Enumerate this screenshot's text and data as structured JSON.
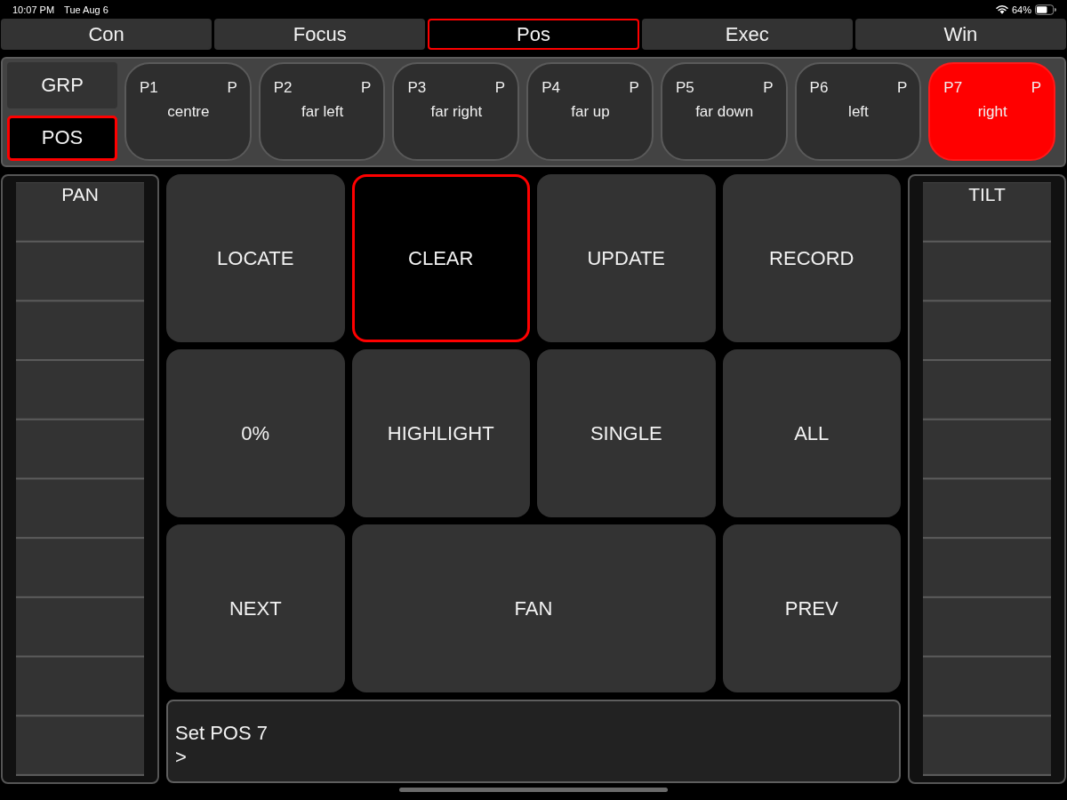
{
  "status_bar": {
    "time": "10:07 PM",
    "date": "Tue Aug 6",
    "battery": "64%"
  },
  "tabs": [
    {
      "label": "Con",
      "selected": false
    },
    {
      "label": "Focus",
      "selected": false
    },
    {
      "label": "Pos",
      "selected": true
    },
    {
      "label": "Exec",
      "selected": false
    },
    {
      "label": "Win",
      "selected": false
    }
  ],
  "palette": {
    "modes": [
      {
        "label": "GRP",
        "selected": false
      },
      {
        "label": "POS",
        "selected": true
      }
    ],
    "presets": [
      {
        "number": "P1",
        "tag": "P",
        "name": "centre",
        "selected": false
      },
      {
        "number": "P2",
        "tag": "P",
        "name": "far left",
        "selected": false
      },
      {
        "number": "P3",
        "tag": "P",
        "name": "far right",
        "selected": false
      },
      {
        "number": "P4",
        "tag": "P",
        "name": "far up",
        "selected": false
      },
      {
        "number": "P5",
        "tag": "P",
        "name": "far down",
        "selected": false
      },
      {
        "number": "P6",
        "tag": "P",
        "name": "left",
        "selected": false
      },
      {
        "number": "P7",
        "tag": "P",
        "name": "right",
        "selected": true
      }
    ]
  },
  "faders": [
    {
      "label": "PAN"
    },
    {
      "label": "TILT"
    }
  ],
  "keys": [
    {
      "label": "LOCATE",
      "kind": "single",
      "active": false
    },
    {
      "label": "CLEAR",
      "kind": "single",
      "active": true
    },
    {
      "label": "UPDATE",
      "kind": "single",
      "active": false
    },
    {
      "label": "RECORD",
      "kind": "single",
      "active": false
    },
    {
      "label": "0%",
      "kind": "single",
      "active": false
    },
    {
      "label": "HIGHLIGHT",
      "kind": "single",
      "active": false
    },
    {
      "label": "SINGLE",
      "kind": "single",
      "active": false
    },
    {
      "label": "ALL",
      "kind": "single",
      "active": false
    },
    {
      "label": "NEXT",
      "kind": "single",
      "active": false
    },
    {
      "label": "FAN",
      "kind": "double",
      "active": false
    },
    {
      "label": "PREV",
      "kind": "single",
      "active": false
    }
  ],
  "command_line": {
    "lines": [
      "Set POS 7",
      ">"
    ]
  }
}
